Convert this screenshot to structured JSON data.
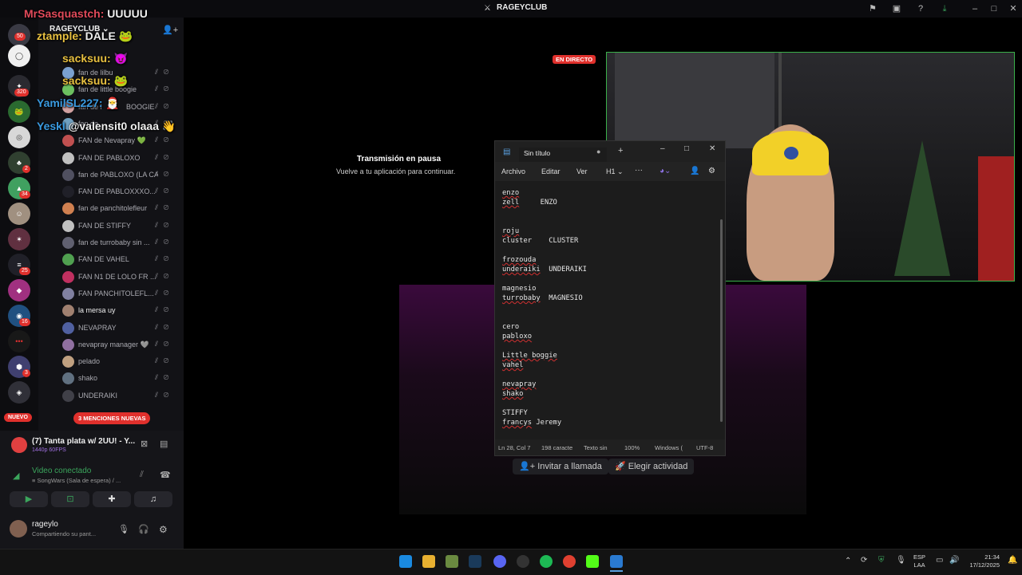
{
  "window_title": "RAGEYCLUB",
  "chat_overlay": [
    {
      "user": "MrSasquastch:",
      "msg": " UUUUU",
      "color": "#e04a5a"
    },
    {
      "user": "ztample:",
      "msg": " DALE",
      "color": "#e8c040"
    },
    {
      "user": "sacksuu:",
      "msg": "",
      "color": "#e8c040"
    },
    {
      "user": "sacksuu:",
      "msg": "",
      "color": "#e8c040"
    },
    {
      "user": "YamilSL227:",
      "msg": "",
      "color": "#3a9ae0"
    },
    {
      "user": "YeskI",
      "msg": " @valensit0 olaaa",
      "color": "#3a9ae0"
    }
  ],
  "server_name": "RAGEYCLUB",
  "rail_badges": [
    "50",
    "320",
    "2",
    "34",
    "25",
    "16",
    "3"
  ],
  "rail_new": "NUEVO",
  "members": [
    {
      "name": "fan de lilbu",
      "color": "#7aa0d0"
    },
    {
      "name": "fan de little boogie",
      "color": "#6cc060"
    },
    {
      "name": "fan de l",
      "suffix": "BOOGIE",
      "color": "#d0a0a0"
    },
    {
      "name": "fan de",
      "color": "#70a0c0"
    },
    {
      "name": "FAN de Nevapray 💚",
      "color": "#c05050"
    },
    {
      "name": "FAN DE PABLOXO",
      "color": "#c0c0c0"
    },
    {
      "name": "fan de PABLOXO (LA CA...",
      "color": "#505060"
    },
    {
      "name": "FAN DE PABLOXXXO...",
      "color": "#202028"
    },
    {
      "name": "fan de panchitolefleur",
      "color": "#d08050"
    },
    {
      "name": "FAN DE STIFFY",
      "color": "#c0c0c0"
    },
    {
      "name": "fan de turrobaby sin ...",
      "color": "#606070"
    },
    {
      "name": "FAN DE VAHEL",
      "color": "#50a050"
    },
    {
      "name": "FAN N1 DE LOLO FR ...",
      "color": "#c03060"
    },
    {
      "name": "FAN PANCHITOLEFL...",
      "color": "#8080a0"
    },
    {
      "name": "la mersa uy",
      "color": "#a08070"
    },
    {
      "name": "NEVAPRAY",
      "color": "#5060a0"
    },
    {
      "name": "nevapray manager 🩶",
      "color": "#9070a0"
    },
    {
      "name": "pelado",
      "color": "#c0a080"
    },
    {
      "name": "shako",
      "color": "#607080"
    },
    {
      "name": "UNDERAIKI",
      "color": "#404048"
    }
  ],
  "mentions_badge": "3 MENCIONES NUEVAS",
  "activity": {
    "title": "(7) Tanta plata w/ 2UU! - Y...",
    "sub": "1440p 60FPS"
  },
  "voice": {
    "status": "Video conectado",
    "channel": "≡ SongWars (Sala de espera) / ..."
  },
  "user": {
    "name": "rageylo",
    "status": "Compartiendo su pant..."
  },
  "stream": {
    "paused_title": "Transmisión en pausa",
    "paused_sub": "Vuelve a tu aplicación para continuar.",
    "live_badge": "EN DIRECTO",
    "invite_label": "Invitar a llamada",
    "activity_label": "Elegir actividad"
  },
  "notepad": {
    "tab_title": "Sin título",
    "menu": [
      "Archivo",
      "Editar",
      "Ver"
    ],
    "heading": "H1",
    "lines": [
      {
        "t": "enzo",
        "sq": true
      },
      {
        "t": "zell",
        "sq": true,
        "extra": "     ENZO"
      },
      {
        "t": ""
      },
      {
        "t": ""
      },
      {
        "t": "roju",
        "sq": true
      },
      {
        "t": "cluster",
        "sq": false,
        "extra": "    CLUSTER"
      },
      {
        "t": ""
      },
      {
        "t": "frozouda",
        "sq": true
      },
      {
        "t": "underaiki",
        "sq": true,
        "extra": "  UNDERAIKI"
      },
      {
        "t": ""
      },
      {
        "t": "magnesio",
        "sq": false
      },
      {
        "t": "turrobaby",
        "sq": true,
        "extra": "  MAGNESIO"
      },
      {
        "t": ""
      },
      {
        "t": ""
      },
      {
        "t": "cero",
        "sq": false
      },
      {
        "t": "pabloxo",
        "sq": true
      },
      {
        "t": ""
      },
      {
        "t": "Little boggie",
        "sq": true
      },
      {
        "t": "vahel",
        "sq": true
      },
      {
        "t": ""
      },
      {
        "t": "nevapray",
        "sq": true
      },
      {
        "t": "shako",
        "sq": true
      },
      {
        "t": ""
      },
      {
        "t": "STIFFY",
        "sq": false
      },
      {
        "t": "francys",
        "sq": true,
        "extra": " Jeremy"
      }
    ],
    "status": {
      "pos": "Ln 28, Col 7",
      "chars": "198 caracte",
      "format": "Texto sin",
      "zoom": "100%",
      "eol": "Windows (",
      "enc": "UTF-8"
    }
  },
  "tray": {
    "lang": "ESP",
    "layout": "LAA",
    "time": "21:34",
    "date": "17/12/2025"
  }
}
